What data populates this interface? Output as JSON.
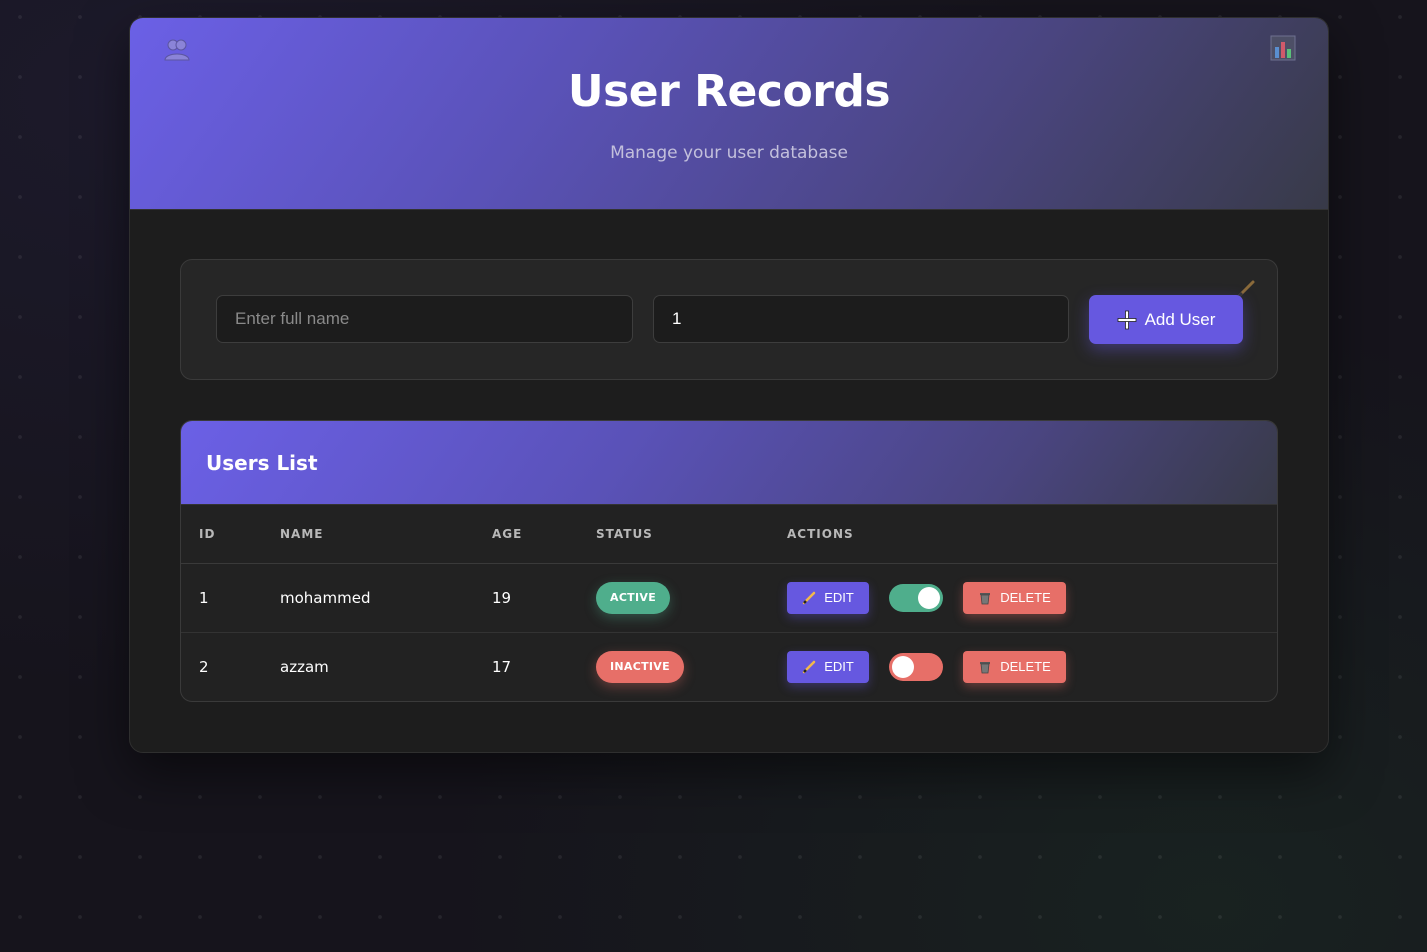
{
  "header": {
    "title": "User Records",
    "subtitle": "Manage your user database"
  },
  "form": {
    "name_placeholder": "Enter full name",
    "name_value": "",
    "age_value": "1",
    "add_label": "Add User"
  },
  "list": {
    "title": "Users List",
    "columns": [
      "ID",
      "NAME",
      "AGE",
      "STATUS",
      "ACTIONS"
    ],
    "rows": [
      {
        "id": "1",
        "name": "mohammed",
        "age": "19",
        "status": "ACTIVE",
        "toggle_on": true,
        "edit_label": "EDIT",
        "delete_label": "DELETE"
      },
      {
        "id": "2",
        "name": "azzam",
        "age": "17",
        "status": "INACTIVE",
        "toggle_on": false,
        "edit_label": "EDIT",
        "delete_label": "DELETE"
      }
    ]
  },
  "colors": {
    "accent": "#6658e0",
    "active": "#4fae8c",
    "inactive": "#e76f68"
  },
  "icons": [
    "users-icon",
    "chart-icon",
    "plus-icon",
    "pencil-icon",
    "trash-icon"
  ]
}
